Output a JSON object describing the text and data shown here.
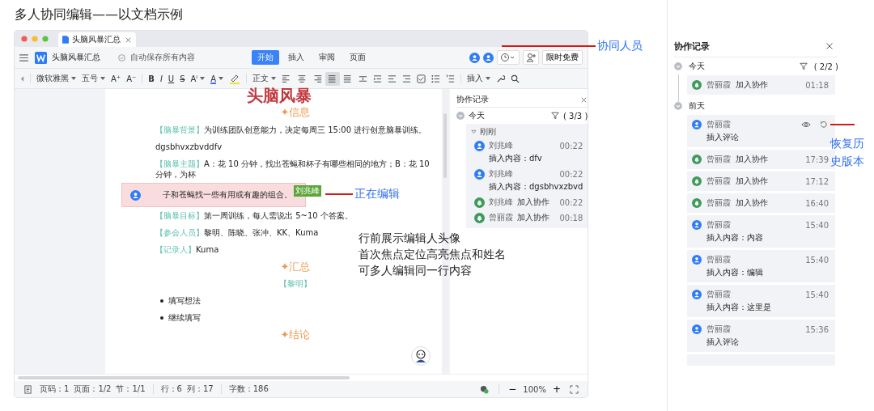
{
  "heading": "多人协同编辑——以文档示例",
  "window": {
    "tab_title": "头脑风暴汇总",
    "doc_title": "头脑风暴汇总",
    "autosave": "自动保存所有内容",
    "ribbon_tabs": [
      {
        "label": "开始",
        "selected": true
      },
      {
        "label": "插入",
        "selected": false
      },
      {
        "label": "审阅",
        "selected": false
      },
      {
        "label": "页面",
        "selected": false
      }
    ],
    "promo_button": "限时免费"
  },
  "toolbar": {
    "font": "微软雅黑",
    "size": "五号",
    "size_buttons": [
      "A⁺",
      "A⁻"
    ],
    "format_buttons": [
      "B",
      "I",
      "U",
      "S"
    ],
    "effect_button": "Aⁱ",
    "color_button": "A",
    "style": "正文",
    "alignments": [
      {
        "kind": "left",
        "selected": false
      },
      {
        "kind": "center",
        "selected": false
      },
      {
        "kind": "right",
        "selected": false
      },
      {
        "kind": "justify",
        "selected": true
      },
      {
        "kind": "distributed",
        "selected": false
      }
    ],
    "insert": "插入"
  },
  "document": {
    "title": "头脑风暴",
    "blocks": [
      {
        "kind": "heading",
        "text": "✦信息"
      },
      {
        "kind": "para",
        "label": "【脑暴背景】",
        "text": "为训练团队创意能力，决定每周三 15:00 进行创意脑暴训练。"
      },
      {
        "kind": "plain",
        "text": "dgsbhvxzbvddfv"
      },
      {
        "kind": "para",
        "label": "【脑暴主题】",
        "text": "A：花 10 分钟，找出苍蝇和杯子有哪些相同的地方；B：花 10 分钟，为杯"
      },
      {
        "kind": "editing",
        "text": "子和苍蝇找一些有用或有趣的组合。",
        "editor": "刘兆峰"
      },
      {
        "kind": "para",
        "label": "【脑暴目标】",
        "text": "第一周训练，每人需说出 5~10 个答案。"
      },
      {
        "kind": "para",
        "label": "【参会人员】",
        "text": "黎明、陈晓、张冲、KK、Kuma"
      },
      {
        "kind": "para",
        "label": "【记录人】",
        "text": "Kuma"
      },
      {
        "kind": "heading",
        "text": "✦汇总"
      },
      {
        "kind": "subheading",
        "text": "【黎明】"
      },
      {
        "kind": "bullet",
        "text": "填写想法"
      },
      {
        "kind": "bullet",
        "text": "继续填写"
      },
      {
        "kind": "heading",
        "text": "✦结论"
      }
    ]
  },
  "side_log": {
    "title": "协作记录",
    "day": "今天",
    "filter": "( 3/3 )",
    "group": "刚刚",
    "entries": [
      {
        "kind": "edit",
        "name": "刘兆峰",
        "time": "00:22",
        "detail": "插入内容：dfv"
      },
      {
        "kind": "edit",
        "name": "刘兆峰",
        "time": "00:22",
        "detail": "插入内容：dgsbhvxzbvd"
      },
      {
        "kind": "join",
        "name": "刘兆峰",
        "action": "加入协作",
        "time": "00:22"
      },
      {
        "kind": "join",
        "name": "曾丽霞",
        "action": "加入协作",
        "time": "00:18"
      }
    ]
  },
  "status_bar": {
    "items": [
      "页码：1",
      "页面：1/2",
      "节：1/1",
      "行：6",
      "列：17",
      "字数：186"
    ],
    "zoom_out": "−",
    "zoom": "100%",
    "zoom_in": "+"
  },
  "history_panel": {
    "title": "协作记录",
    "groups": [
      {
        "label": "今天",
        "filter": "( 2/2 )",
        "entries": [
          {
            "kind": "join",
            "name": "曾丽霞",
            "action": "加入协作",
            "time": "01:18",
            "hovered": false
          }
        ]
      },
      {
        "label": "前天",
        "entries": [
          {
            "kind": "edit",
            "name": "曾丽霞",
            "detail": "插入评论",
            "hovered": true
          },
          {
            "kind": "join",
            "name": "曾丽霞",
            "action": "加入协作",
            "time": "17:39",
            "hovered": false
          },
          {
            "kind": "join",
            "name": "曾丽霞",
            "action": "加入协作",
            "time": "17:12",
            "hovered": false
          },
          {
            "kind": "join",
            "name": "曾丽霞",
            "action": "加入协作",
            "time": "16:40",
            "hovered": false
          },
          {
            "kind": "edit",
            "name": "曾丽霞",
            "time": "15:40",
            "detail": "插入内容：内容",
            "hovered": false
          },
          {
            "kind": "edit",
            "name": "曾丽霞",
            "time": "15:40",
            "detail": "插入内容：编辑",
            "hovered": false
          },
          {
            "kind": "edit",
            "name": "曾丽霞",
            "time": "15:40",
            "detail": "插入内容：这里是",
            "hovered": false
          },
          {
            "kind": "edit",
            "name": "曾丽霞",
            "time": "15:36",
            "detail": "插入评论",
            "hovered": false
          }
        ]
      }
    ]
  },
  "annotations": {
    "collaborators": "协同人员",
    "editing": "正在编辑",
    "notes": [
      "行前展示编辑人头像",
      "首次焦点定位高亮焦点和姓名",
      "可多人编辑同一行内容"
    ],
    "restore": "恢复历史版本"
  }
}
